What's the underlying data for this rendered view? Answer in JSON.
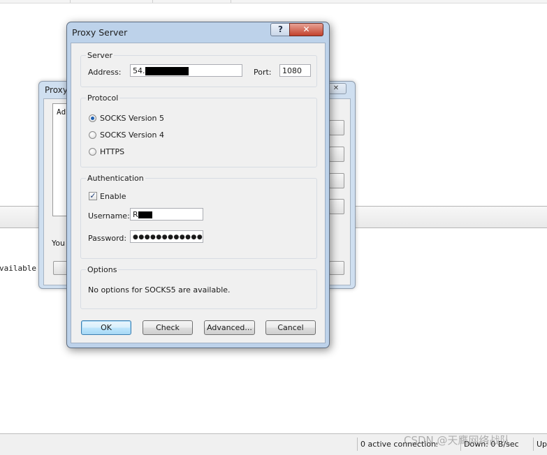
{
  "background": {
    "visible_text": "vailable.",
    "status_connections": "0 active connections",
    "status_down": "Down: 0 B/sec",
    "status_up": "Up",
    "watermark": "CSDN @天鹰网络战队"
  },
  "back_dialog": {
    "title": "Proxy",
    "close_glyph": "✕",
    "list_header": "Ad",
    "footer_text": "You"
  },
  "dialog": {
    "title": "Proxy Server",
    "help_glyph": "?",
    "close_glyph": "✕",
    "server": {
      "legend": "Server",
      "address_label": "Address:",
      "address_value": "54.",
      "port_label": "Port:",
      "port_value": "1080"
    },
    "protocol": {
      "legend": "Protocol",
      "options": [
        {
          "label": "SOCKS Version 5",
          "selected": true
        },
        {
          "label": "SOCKS Version 4",
          "selected": false
        },
        {
          "label": "HTTPS",
          "selected": false
        }
      ]
    },
    "authentication": {
      "legend": "Authentication",
      "enable_label": "Enable",
      "enable_checked": true,
      "check_glyph": "✓",
      "username_label": "Username:",
      "username_value": "R",
      "password_label": "Password:",
      "password_value": "●●●●●●●●●●●●"
    },
    "options": {
      "legend": "Options",
      "text": "No options for SOCKS5 are available."
    },
    "buttons": {
      "ok": "OK",
      "check": "Check",
      "advanced": "Advanced...",
      "cancel": "Cancel"
    }
  },
  "colors": {
    "title_frame": "#bdd2ea",
    "close_red": "#c2412d",
    "radio_dot": "#1d5fb0"
  }
}
